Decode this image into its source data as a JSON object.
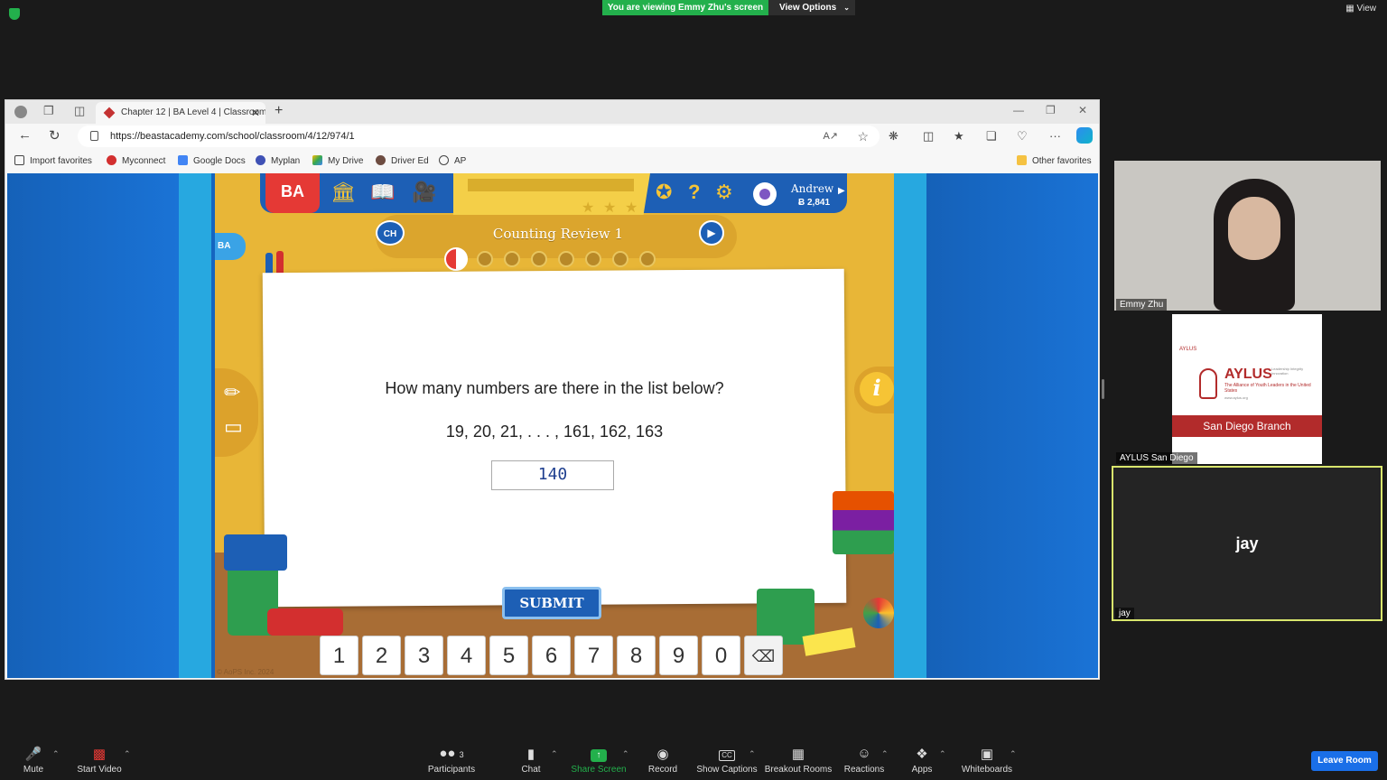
{
  "zoom": {
    "share_banner": "You are viewing Emmy Zhu's screen",
    "view_options": "View Options",
    "top_view": "View",
    "toolbar": {
      "mute": "Mute",
      "start_video": "Start Video",
      "participants": "Participants",
      "participants_count": "3",
      "chat": "Chat",
      "share_screen": "Share Screen",
      "record": "Record",
      "show_captions": "Show Captions",
      "breakout_rooms": "Breakout Rooms",
      "reactions": "Reactions",
      "apps": "Apps",
      "whiteboards": "Whiteboards",
      "leave_room": "Leave Room"
    },
    "participants": [
      {
        "name": "Emmy Zhu"
      },
      {
        "name": "AYLUS San Diego"
      },
      {
        "name": "jay"
      }
    ],
    "aylus_card": {
      "small_logo": "AYLUS",
      "logo": "AYLUS",
      "tagline": "Leadership Integrity Innovation",
      "subtitle": "The Alliance of Youth Leaders in the United States",
      "url": "www.aylus.org",
      "branch": "San Diego Branch"
    },
    "accent_green": "#23b04c",
    "accent_blue": "#1a6fe8"
  },
  "browser": {
    "tab_title": "Chapter 12 | BA Level 4 | Classroom",
    "url": "https://beastacademy.com/school/classroom/4/12/974/1",
    "favorites": [
      {
        "label": "Import favorites"
      },
      {
        "label": "Myconnect"
      },
      {
        "label": "Google Docs"
      },
      {
        "label": "Myplan"
      },
      {
        "label": "My Drive"
      },
      {
        "label": "Driver Ed"
      },
      {
        "label": "AP"
      }
    ],
    "other_favorites": "Other favorites"
  },
  "game": {
    "logo": "BA",
    "small_logo": "BA",
    "user": "Andrew",
    "coins": "Ƀ 2,841",
    "chapter_badge": "CH",
    "lesson_title": "Counting Review 1",
    "question": "How many numbers are there in the list below?",
    "sequence": "19, 20, 21, . . . , 161, 162, 163",
    "answer": "140",
    "submit": "SUBMIT",
    "keys": [
      "1",
      "2",
      "3",
      "4",
      "5",
      "6",
      "7",
      "8",
      "9",
      "0"
    ],
    "info": "i",
    "copyright": "© AoPS Inc. 2024",
    "colors": {
      "game_bg": "#e8b637",
      "nav_blue": "#1d5fb5",
      "logo_red": "#e53935"
    }
  }
}
